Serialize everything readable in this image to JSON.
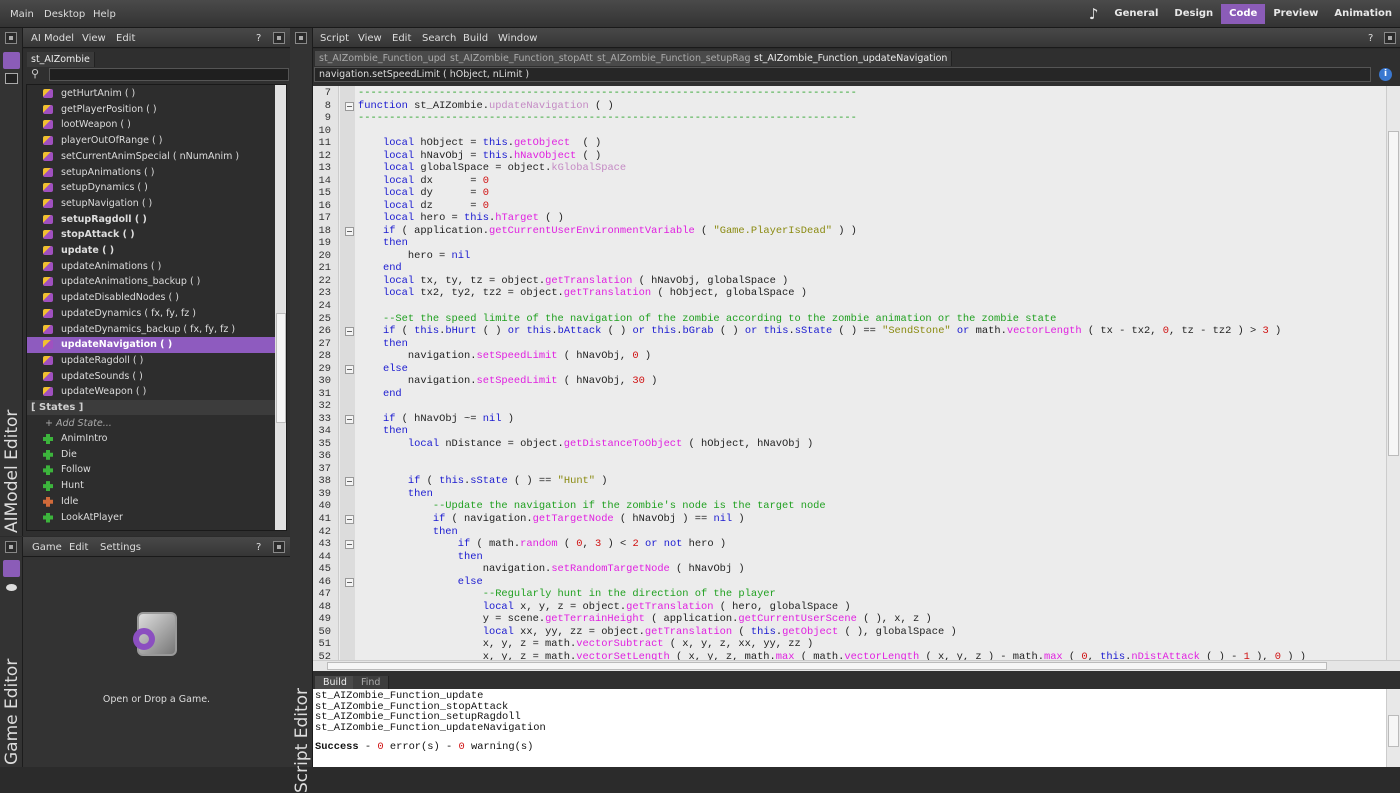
{
  "menubar": {
    "items": [
      "Main",
      "Desktop",
      "Help"
    ],
    "modes": [
      "General",
      "Design",
      "Code",
      "Preview",
      "Animation"
    ],
    "active_mode": "Code",
    "music_icon": "music-note-icon"
  },
  "aimodel": {
    "title": "AIModel Editor",
    "menu": [
      "AI Model",
      "View",
      "Edit"
    ],
    "help": "?",
    "tab": "st_AIZombie",
    "search_value": "",
    "functions": [
      {
        "label": "getHurtAnim ( )",
        "bold": false
      },
      {
        "label": "getPlayerPosition ( )",
        "bold": false
      },
      {
        "label": "lootWeapon ( )",
        "bold": false
      },
      {
        "label": "playerOutOfRange ( )",
        "bold": false
      },
      {
        "label": "setCurrentAnimSpecial ( nNumAnim )",
        "bold": false
      },
      {
        "label": "setupAnimations ( )",
        "bold": false
      },
      {
        "label": "setupDynamics ( )",
        "bold": false
      },
      {
        "label": "setupNavigation ( )",
        "bold": false
      },
      {
        "label": "setupRagdoll ( )",
        "bold": true
      },
      {
        "label": "stopAttack ( )",
        "bold": true
      },
      {
        "label": "update ( )",
        "bold": true
      },
      {
        "label": "updateAnimations ( )",
        "bold": false
      },
      {
        "label": "updateAnimations_backup ( )",
        "bold": false
      },
      {
        "label": "updateDisabledNodes ( )",
        "bold": false
      },
      {
        "label": "updateDynamics ( fx, fy, fz )",
        "bold": false
      },
      {
        "label": "updateDynamics_backup ( fx, fy, fz )",
        "bold": false
      },
      {
        "label": "updateNavigation ( )",
        "bold": true,
        "selected": true
      },
      {
        "label": "updateRagdoll ( )",
        "bold": false
      },
      {
        "label": "updateSounds ( )",
        "bold": false
      },
      {
        "label": "updateWeapon ( )",
        "bold": false
      }
    ],
    "states_header": "[ States ]",
    "add_state": "+ Add State...",
    "states": [
      {
        "label": "AnimIntro",
        "color": "green"
      },
      {
        "label": "Die",
        "color": "green"
      },
      {
        "label": "Follow",
        "color": "green"
      },
      {
        "label": "Hunt",
        "color": "green"
      },
      {
        "label": "Idle",
        "color": "orange"
      },
      {
        "label": "LookAtPlayer",
        "color": "green"
      }
    ]
  },
  "game": {
    "title": "Game Editor",
    "menu": [
      "Game",
      "Edit",
      "Settings"
    ],
    "help": "?",
    "message": "Open or Drop a Game."
  },
  "script": {
    "title": "Script Editor",
    "menu": [
      "Script",
      "View",
      "Edit",
      "Search",
      "Build",
      "Window"
    ],
    "help": "?",
    "tabs": [
      "st_AIZombie_Function_update",
      "st_AIZombie_Function_stopAttack",
      "st_AIZombie_Function_setupRagdoll",
      "st_AIZombie_Function_updateNavigation"
    ],
    "active_tab": 3,
    "signature": "navigation.setSpeedLimit ( hObject, nLimit )",
    "first_line": 7,
    "fold_lines": [
      8,
      18,
      26,
      29,
      33,
      38,
      41,
      43,
      46
    ],
    "lines": [
      "{c:--------------------------------------------------------------------------------}",
      "{k:function} st_AIZombie.{p:updateNavigation} ( )",
      "{c:--------------------------------------------------------------------------------}",
      "",
      "    {k:local} hObject = {k:this}.{f:getObject}  ( )",
      "    {k:local} hNavObj = {k:this}.{f:hNavObject} ( )",
      "    {k:local} globalSpace = object.{p:kGlobalSpace}",
      "    {k:local} dx      = {n:0}",
      "    {k:local} dy      = {n:0}",
      "    {k:local} dz      = {n:0}",
      "    {k:local} hero = {k:this}.{f:hTarget} ( )",
      "    {k:if} ( application.{f:getCurrentUserEnvironmentVariable} ( {s:\"Game.PlayerIsDead\"} ) )",
      "    {k:then}",
      "        hero = {k:nil}",
      "    {k:end}",
      "    {k:local} tx, ty, tz = object.{f:getTranslation} ( hNavObj, globalSpace )",
      "    {k:local} tx2, ty2, tz2 = object.{f:getTranslation} ( hObject, globalSpace )",
      "",
      "    {c:--Set the speed limite of the navigation of the zombie according to the zombie animation or the zombie state}",
      "    {k:if} ( {k:this}.{k:bHurt} ( ) {k:or} {k:this}.{k:bAttack} ( ) {k:or} {k:this}.{k:bGrab} ( ) {k:or} {k:this}.{k:sState} ( ) == {s:\"SendStone\"} {k:or} math.{f:vectorLength} ( tx - tx2, {n:0}, tz - tz2 ) > {n:3} )",
      "    {k:then}",
      "        navigation.{f:setSpeedLimit} ( hNavObj, {n:0} )",
      "    {k:else}",
      "        navigation.{f:setSpeedLimit} ( hNavObj, {n:30} )",
      "    {k:end}",
      "",
      "    {k:if} ( hNavObj ~= {k:nil} )",
      "    {k:then}",
      "        {k:local} nDistance = object.{f:getDistanceToObject} ( hObject, hNavObj )",
      "",
      "",
      "        {k:if} ( {k:this}.{k:sState} ( ) == {s:\"Hunt\"} )",
      "        {k:then}",
      "            {c:--Update the navigation if the zombie's node is the target node}",
      "            {k:if} ( navigation.{f:getTargetNode} ( hNavObj ) == {k:nil} )",
      "            {k:then}",
      "                {k:if} ( math.{f:random} ( {n:0}, {n:3} ) < {n:2} {k:or} {k:not} hero )",
      "                {k:then}",
      "                    navigation.{f:setRandomTargetNode} ( hNavObj )",
      "                {k:else}",
      "                    {c:--Regularly hunt in the direction of the player}",
      "                    {k:local} x, y, z = object.{f:getTranslation} ( hero, globalSpace )",
      "                    y = scene.{f:getTerrainHeight} ( application.{f:getCurrentUserScene} ( ), x, z )",
      "                    {k:local} xx, yy, zz = object.{f:getTranslation} ( {k:this}.{f:getObject} ( ), globalSpace )",
      "                    x, y, z = math.{f:vectorSubtract} ( x, y, z, xx, yy, zz )",
      "                    x, y, z = math.{f:vectorSetLength} ( x, y, z, math.{f:max} ( math.{f:vectorLength} ( x, y, z ) - math.{f:max} ( {n:0}, {k:this}.{f:nDistAttack} ( ) - {n:1} ), {n:0} ) )"
    ]
  },
  "build": {
    "tabs": [
      "Build",
      "Find"
    ],
    "active_tab": "Build",
    "output": [
      "st_AIZombie_Function_update",
      "st_AIZombie_Function_stopAttack",
      "st_AIZombie_Function_setupRagdoll",
      "st_AIZombie_Function_updateNavigation"
    ],
    "result": {
      "status": "Success",
      "sep1": " - ",
      "errors": "0",
      "errors_label": " error(s)",
      "sep2": " - ",
      "warnings": "0",
      "warnings_label": " warning(s)"
    }
  },
  "colors": {
    "accent": "#8b5cb8",
    "keyword": "#1a1ad0",
    "function": "#e020e0",
    "string": "#8a8a10",
    "number": "#d01010",
    "comment": "#20a020"
  }
}
